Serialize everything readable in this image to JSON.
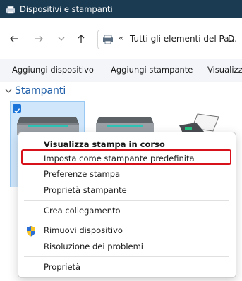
{
  "window": {
    "title": "Dispositivi e stampanti",
    "icon": "devices-printers-icon"
  },
  "nav": {
    "back_icon": "arrow-left-icon",
    "forward_icon": "arrow-right-icon",
    "recent_icon": "chevron-down-icon",
    "up_icon": "arrow-up-icon",
    "address_separator": "«",
    "address_text": "Tutti gli elementi del Pa...",
    "address_next": "D"
  },
  "commands": [
    "Aggiungi dispositivo",
    "Aggiungi stampante",
    "Visualizza"
  ],
  "section": {
    "label": "Stampanti",
    "expanded": true
  },
  "context_menu": {
    "items": [
      {
        "label": "Visualizza stampa in corso",
        "bold": true
      },
      {
        "label": "Imposta come stampante predefinita",
        "highlighted": true
      },
      {
        "label": "Preferenze stampa"
      },
      {
        "label": "Proprietà stampante"
      },
      {
        "label": "Crea collegamento"
      },
      {
        "label": "Rimuovi dispositivo",
        "icon": "shield-icon"
      },
      {
        "label": "Risoluzione dei problemi"
      },
      {
        "label": "Proprietà"
      }
    ]
  },
  "colors": {
    "titlebar": "#1b3b52",
    "selection_bg": "#cfe6fb",
    "highlight_border": "#d8121a",
    "section_label": "#1f5ea8"
  }
}
